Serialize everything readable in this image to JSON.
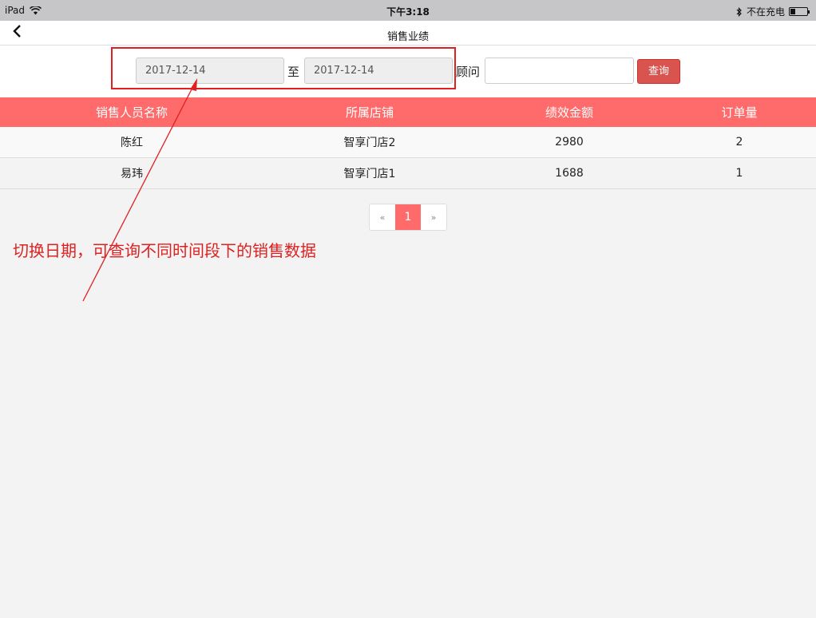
{
  "status_bar": {
    "device": "iPad",
    "time": "下午3:18",
    "charging": "不在充电",
    "battery_level": 0.3
  },
  "nav": {
    "title": "销售业绩"
  },
  "filter": {
    "start_date": "2017-12-14",
    "separator": "至",
    "end_date": "2017-12-14",
    "advisor_label": "顾问",
    "advisor_value": "",
    "query_label": "查询"
  },
  "table": {
    "headers": [
      "销售人员名称",
      "所属店铺",
      "绩效金额",
      "订单量"
    ],
    "rows": [
      [
        "陈红",
        "智享门店2",
        "2980",
        "2"
      ],
      [
        "易玮",
        "智享门店1",
        "1688",
        "1"
      ]
    ]
  },
  "pagination": {
    "prev": "«",
    "current": "1",
    "next": "»"
  },
  "annotation": {
    "text": "切换日期，可查询不同时间段下的销售数据"
  },
  "colors": {
    "header": "#ff6b6b",
    "accent_button": "#d9534f",
    "annotation": "#e02020"
  }
}
